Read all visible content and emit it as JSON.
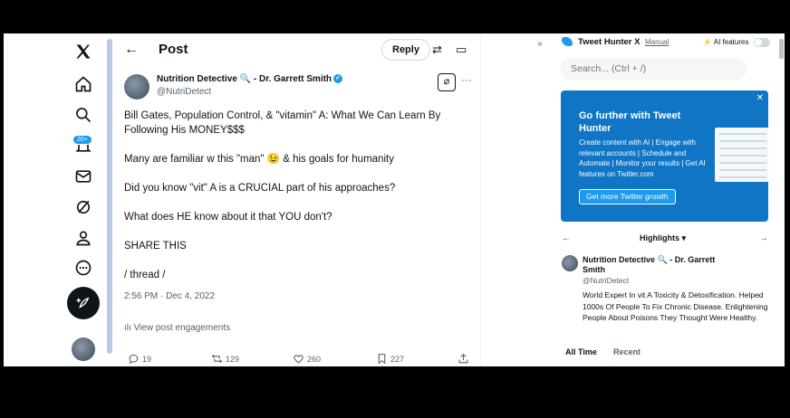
{
  "post": {
    "header_title": "Post",
    "reply_label": "Reply",
    "author_name": "Nutrition Detective 🔍 - Dr. Garrett Smith",
    "author_handle": "@NutriDetect",
    "text_lines": [
      "Bill Gates, Population Control, & \"vitamin\" A: What We Can Learn By",
      "Following His MONEY$$$",
      "Many are familiar w this \"man\" 😉 & his goals for humanity",
      "Did you know \"vit\" A is a CRUCIAL part of his approaches?",
      "What does HE know about it that YOU don't?",
      "SHARE THIS",
      "/ thread /"
    ],
    "timestamp": "2:56 PM · Dec 4, 2022",
    "engagements_label": "View post engagements",
    "actions": {
      "replies": "19",
      "reposts": "129",
      "likes": "260",
      "bookmarks": "227"
    }
  },
  "nav": {
    "notifications_badge": "20+"
  },
  "extension": {
    "title": "Tweet Hunter X",
    "manual_label": "Manual",
    "ai_label": "AI features",
    "search_placeholder": "Search... (Ctrl + /)",
    "promo": {
      "title": "Go further with Tweet Hunter",
      "description": "Create content with AI | Engage with relevant accounts | Schedule and Automate | Monitor your results | Get AI features on Twitter.com",
      "button": "Get more Twitter growth"
    },
    "highlights_label": "Highlights ▾",
    "highlight_profile": {
      "name": "Nutrition Detective 🔍 - Dr. Garrett Smith",
      "handle": "@NutriDetect",
      "bio": "World Expert In vit A Toxicity & Detoxification. Helped 1000s Of People To Fix Chronic Disease. Enlightening People About Poisons They Thought Were Healthy."
    },
    "tabs": [
      "All Time",
      "Recent"
    ]
  },
  "colors": {
    "accent": "#1d9bf0",
    "promo_bg": "#0f75c4",
    "text_primary": "#0f1419",
    "text_secondary": "#536471"
  }
}
